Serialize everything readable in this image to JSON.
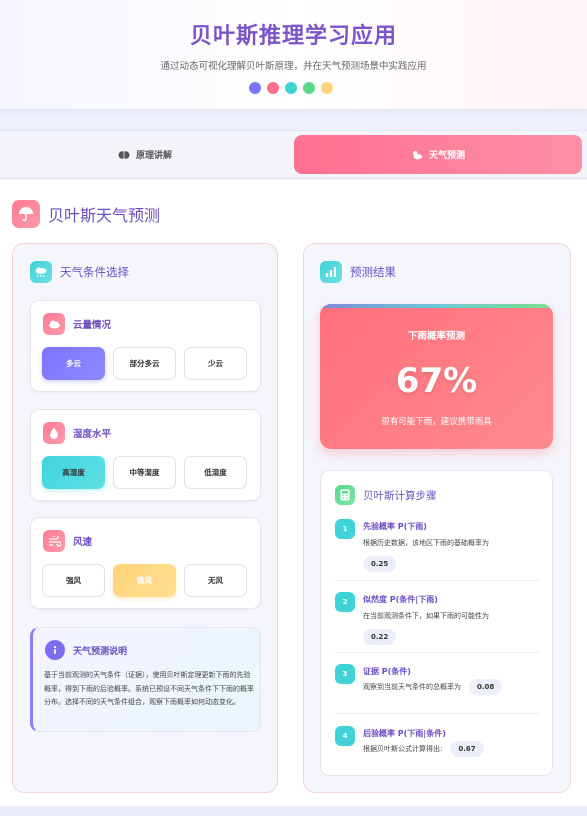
{
  "header": {
    "title": "贝叶斯推理学习应用",
    "subtitle": "通过动态可视化理解贝叶斯原理，并在天气预测场景中实践应用",
    "dot_colors": [
      "#7b74ff",
      "#ff6f8e",
      "#3fd2d8",
      "#59d88e",
      "#ffd37a"
    ]
  },
  "tabs": [
    {
      "label": "原理讲解",
      "icon": "brain-icon",
      "active": false
    },
    {
      "label": "天气预测",
      "icon": "cloud-sun-icon",
      "active": true
    }
  ],
  "section": {
    "title": "贝叶斯天气预测",
    "icon": "umbrella-icon"
  },
  "conditions": {
    "title": "天气条件选择",
    "groups": [
      {
        "title": "云量情况",
        "icon": "cloud-icon",
        "options": [
          "多云",
          "部分多云",
          "少云"
        ],
        "selected": 0
      },
      {
        "title": "湿度水平",
        "icon": "droplet-icon",
        "options": [
          "高湿度",
          "中等湿度",
          "低湿度"
        ],
        "selected": 0
      },
      {
        "title": "风速",
        "icon": "wind-icon",
        "options": [
          "强风",
          "微风",
          "无风"
        ],
        "selected": 1
      }
    ],
    "info": {
      "title": "天气预测说明",
      "text": "基于当前观测的天气条件（证据），使用贝叶斯定理更新下雨的先验概率，得到下雨的后验概率。系统已预设不同天气条件下下雨的概率分布。选择不同的天气条件组合，观察下雨概率如何动态变化。"
    }
  },
  "result": {
    "title": "预测结果",
    "card_title": "下雨概率预测",
    "probability": "67%",
    "note": "很有可能下雨，建议携带雨具"
  },
  "steps": {
    "title": "贝叶斯计算步骤",
    "items": [
      {
        "num": "1",
        "title": "先验概率 P(下雨)",
        "desc": "根据历史数据，该地区下雨的基础概率为",
        "value": "0.25"
      },
      {
        "num": "2",
        "title": "似然度 P(条件|下雨)",
        "desc": "在当前观测条件下，如果下雨的可能性为",
        "value": "0.22"
      },
      {
        "num": "3",
        "title": "证据 P(条件)",
        "desc": "观察到当前天气条件的总概率为",
        "value": "0.08"
      },
      {
        "num": "4",
        "title": "后验概率 P(下雨|条件)",
        "desc": "根据贝叶斯公式计算得出:",
        "value": "0.67"
      }
    ]
  }
}
